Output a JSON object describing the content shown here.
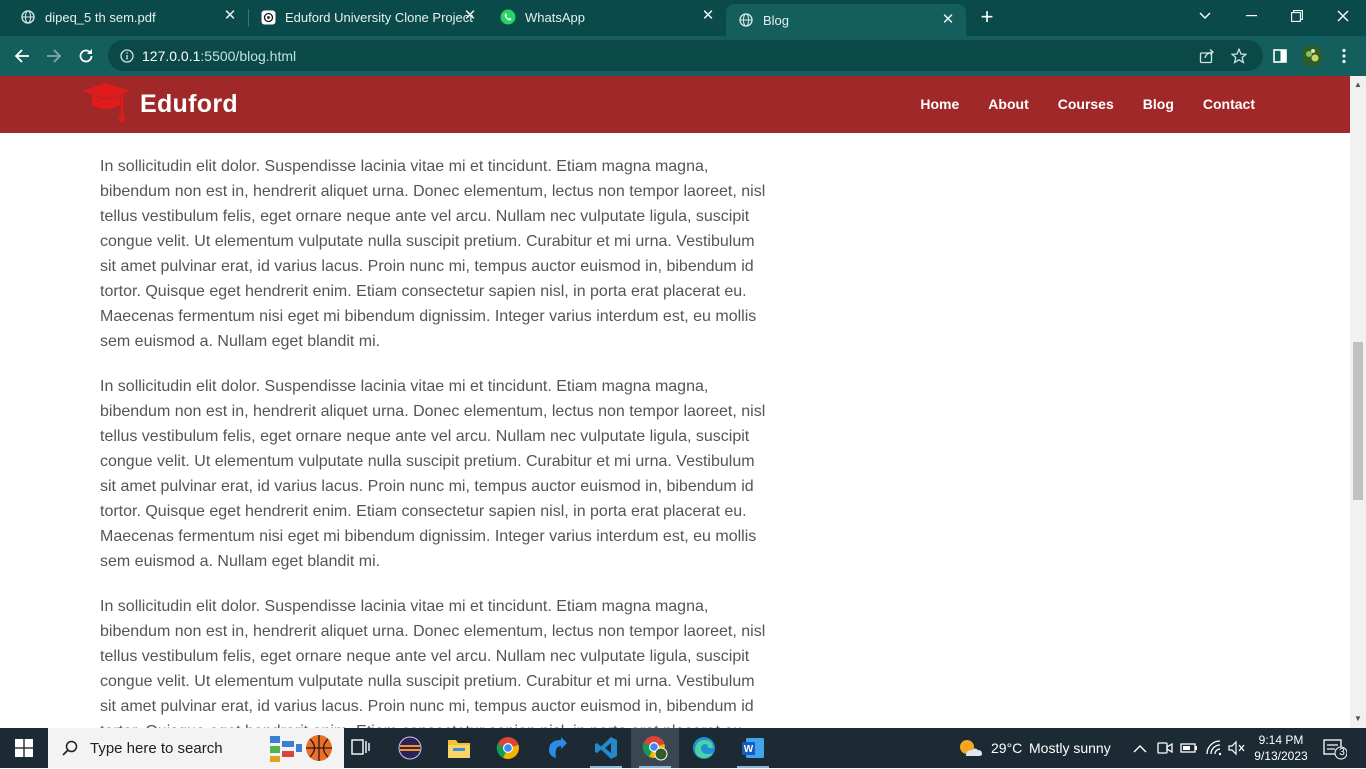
{
  "browser": {
    "tabs": [
      {
        "title": "dipeq_5 th sem.pdf",
        "icon": "globe-icon"
      },
      {
        "title": "Eduford University Clone Project",
        "icon": "openai-icon"
      },
      {
        "title": "WhatsApp",
        "icon": "whatsapp-icon"
      },
      {
        "title": "Blog",
        "icon": "globe-icon",
        "active": true
      }
    ],
    "url_host": "127.0.0.1",
    "url_path": ":5500/blog.html"
  },
  "site": {
    "brand": "Eduford",
    "nav": [
      "Home",
      "About",
      "Courses",
      "Blog",
      "Contact"
    ],
    "accent": "#a12828"
  },
  "article": {
    "paragraphs": [
      "In sollicitudin elit dolor. Suspendisse lacinia vitae mi et tincidunt. Etiam magna magna, bibendum non est in, hendrerit aliquet urna. Donec elementum, lectus non tempor laoreet, nisl tellus vestibulum felis, eget ornare neque ante vel arcu. Nullam nec vulputate ligula, suscipit congue velit. Ut elementum vulputate nulla suscipit pretium. Curabitur et mi urna. Vestibulum sit amet pulvinar erat, id varius lacus. Proin nunc mi, tempus auctor euismod in, bibendum id tortor. Quisque eget hendrerit enim. Etiam consectetur sapien nisl, in porta erat placerat eu. Maecenas fermentum nisi eget mi bibendum dignissim. Integer varius interdum est, eu mollis sem euismod a. Nullam eget blandit mi.",
      "In sollicitudin elit dolor. Suspendisse lacinia vitae mi et tincidunt. Etiam magna magna, bibendum non est in, hendrerit aliquet urna. Donec elementum, lectus non tempor laoreet, nisl tellus vestibulum felis, eget ornare neque ante vel arcu. Nullam nec vulputate ligula, suscipit congue velit. Ut elementum vulputate nulla suscipit pretium. Curabitur et mi urna. Vestibulum sit amet pulvinar erat, id varius lacus. Proin nunc mi, tempus auctor euismod in, bibendum id tortor. Quisque eget hendrerit enim. Etiam consectetur sapien nisl, in porta erat placerat eu. Maecenas fermentum nisi eget mi bibendum dignissim. Integer varius interdum est, eu mollis sem euismod a. Nullam eget blandit mi.",
      "In sollicitudin elit dolor. Suspendisse lacinia vitae mi et tincidunt. Etiam magna magna, bibendum non est in, hendrerit aliquet urna. Donec elementum, lectus non tempor laoreet, nisl tellus vestibulum felis, eget ornare neque ante vel arcu. Nullam nec vulputate ligula, suscipit congue velit. Ut elementum vulputate nulla suscipit pretium. Curabitur et mi urna. Vestibulum sit amet pulvinar erat, id varius lacus. Proin nunc mi, tempus auctor euismod in, bibendum id tortor. Quisque eget hendrerit enim. Etiam consectetur sapien nisl, in porta erat placerat eu."
    ]
  },
  "taskbar": {
    "search_placeholder": "Type here to search",
    "weather_temp": "29°C",
    "weather_text": "Mostly sunny",
    "time": "9:14 PM",
    "date": "9/13/2023",
    "notification_count": "3"
  }
}
